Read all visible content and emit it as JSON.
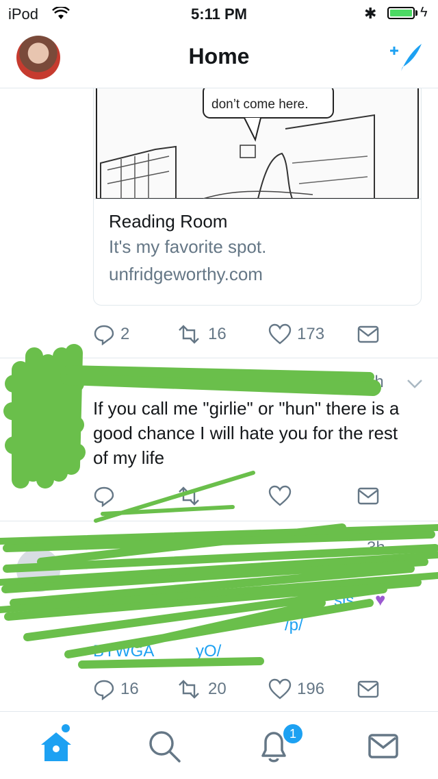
{
  "status_bar": {
    "carrier": "iPod",
    "time": "5:11 PM",
    "battery_level": 0.95
  },
  "nav": {
    "title": "Home"
  },
  "tweets": [
    {
      "card": {
        "image_caption": "don’t come here.",
        "title": "Reading Room",
        "description": "It's my favorite spot.",
        "domain": "unfridgeworthy.com"
      },
      "replies": "2",
      "retweets": "16",
      "likes": "173"
    },
    {
      "time": "3h",
      "text": "If you call me \"girlie\" or \"hun\" there is a good chance I will hate you for the rest of my life",
      "replies": "",
      "retweets": "",
      "likes": ""
    },
    {
      "time": "3h",
      "text_fragments": [
        "sis",
        "/p/",
        "BYWGA",
        "yO/"
      ],
      "replies": "16",
      "retweets": "20",
      "likes": "196"
    }
  ],
  "tabbar": {
    "notifications_badge": "1"
  },
  "colors": {
    "accent": "#1da1f2",
    "scribble": "#6abf4b",
    "muted": "#657786"
  }
}
